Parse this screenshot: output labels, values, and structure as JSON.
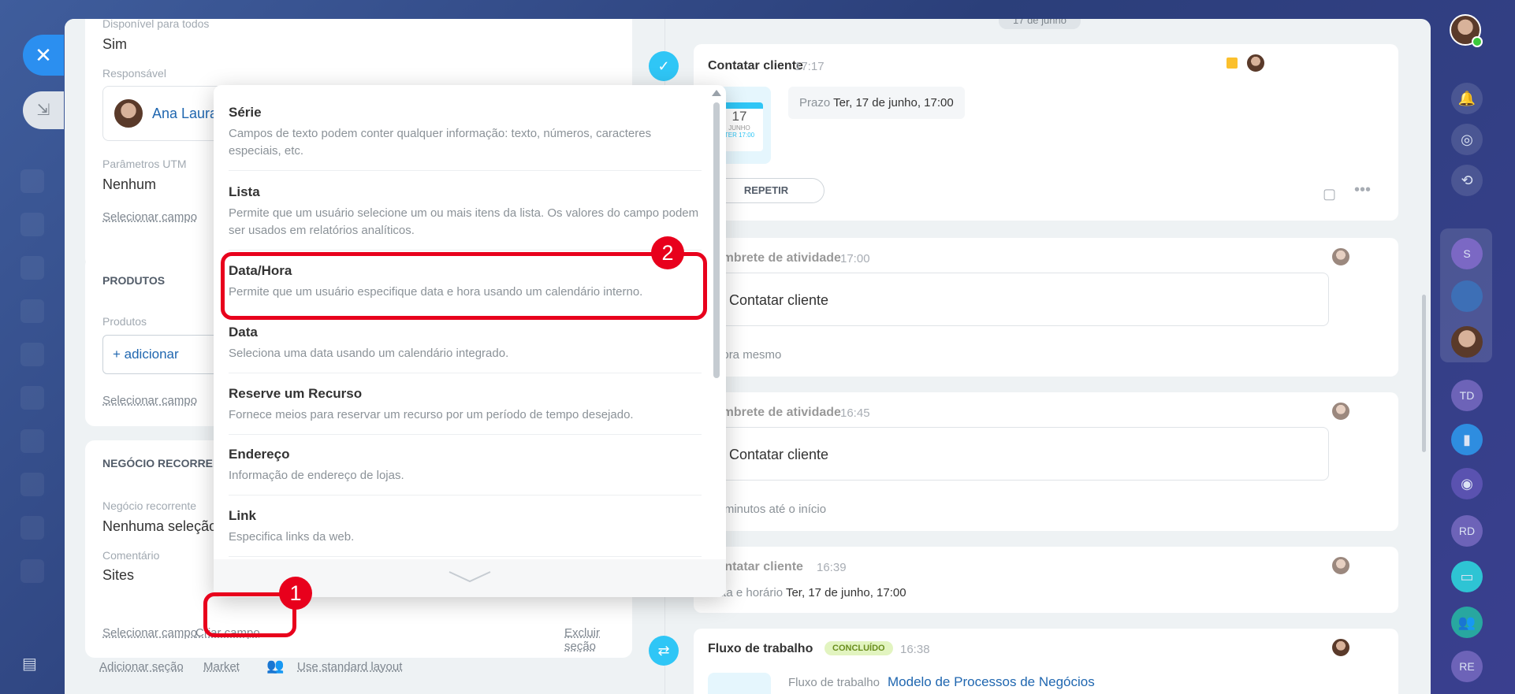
{
  "left_panel": {
    "available_label": "Disponível para todos",
    "available_value": "Sim",
    "responsible_label": "Responsável",
    "responsible_name": "Ana Laura",
    "utm_label": "Parâmetros UTM",
    "utm_value": "Nenhum",
    "select_field_1": "Selecionar campo",
    "products_section": "PRODUTOS",
    "products_label": "Produtos",
    "add_product": "+ adicionar",
    "select_field_2": "Selecionar campo",
    "recurring_section": "NEGÓCIO RECORRENTE",
    "recurring_label": "Negócio recorrente",
    "recurring_value": "Nenhuma seleção",
    "comment_label": "Comentário",
    "comment_value": "Sites",
    "select_field_3": "Selecionar campo",
    "create_field": "Criar campo",
    "delete_section": "Excluir seção",
    "add_section": "Adicionar seção",
    "market": "Market",
    "standard_layout": "Use standard layout"
  },
  "popup": {
    "options": [
      {
        "title": "Série",
        "desc": "Campos de texto podem conter qualquer informação: texto, números, caracteres especiais, etc."
      },
      {
        "title": "Lista",
        "desc": "Permite que um usuário selecione um ou mais itens da lista. Os valores do campo podem ser usados em relatórios analíticos."
      },
      {
        "title": "Data/Hora",
        "desc": "Permite que um usuário especifique data e hora usando um calendário interno."
      },
      {
        "title": "Data",
        "desc": "Seleciona uma data usando um calendário integrado."
      },
      {
        "title": "Reserve um Recurso",
        "desc": "Fornece meios para reservar um recurso por um período de tempo desejado."
      },
      {
        "title": "Endereço",
        "desc": "Informação de endereço de lojas."
      },
      {
        "title": "Link",
        "desc": "Especifica links da web."
      }
    ]
  },
  "annotations": {
    "badge1": "1",
    "badge2": "2"
  },
  "timeline": {
    "date_chip": "17 de junho",
    "card1": {
      "title": "Contatar cliente",
      "time": "17:17",
      "cal_day": "17",
      "cal_month": "JUNHO",
      "cal_sub": "TER 17:00",
      "deadline_label": "Prazo",
      "deadline_value": "Ter, 17 de junho, 17:00",
      "repeat": "REPETIR"
    },
    "card2": {
      "title": "Lembrete de atividade",
      "time": "17:00",
      "body": "Contatar cliente",
      "foot": "Agora mesmo"
    },
    "card3": {
      "title": "Lembrete de atividade",
      "time": "16:45",
      "body": "Contatar cliente",
      "foot": "15 minutos até o início"
    },
    "card4": {
      "title": "Contatar cliente",
      "time": "16:39",
      "label": "Data e horário",
      "value": "Ter, 17 de junho, 17:00"
    },
    "card5": {
      "title": "Fluxo de trabalho",
      "status": "CONCLUÍDO",
      "time": "16:38",
      "label": "Fluxo de trabalho",
      "link": "Modelo de Processos de Negócios"
    }
  },
  "right_sidebar": {
    "s": "S",
    "td": "TD",
    "rd": "RD",
    "re": "RE"
  },
  "colors": {
    "accent": "#2fc6f6",
    "link": "#2067b0",
    "annotation": "#e8001c"
  }
}
